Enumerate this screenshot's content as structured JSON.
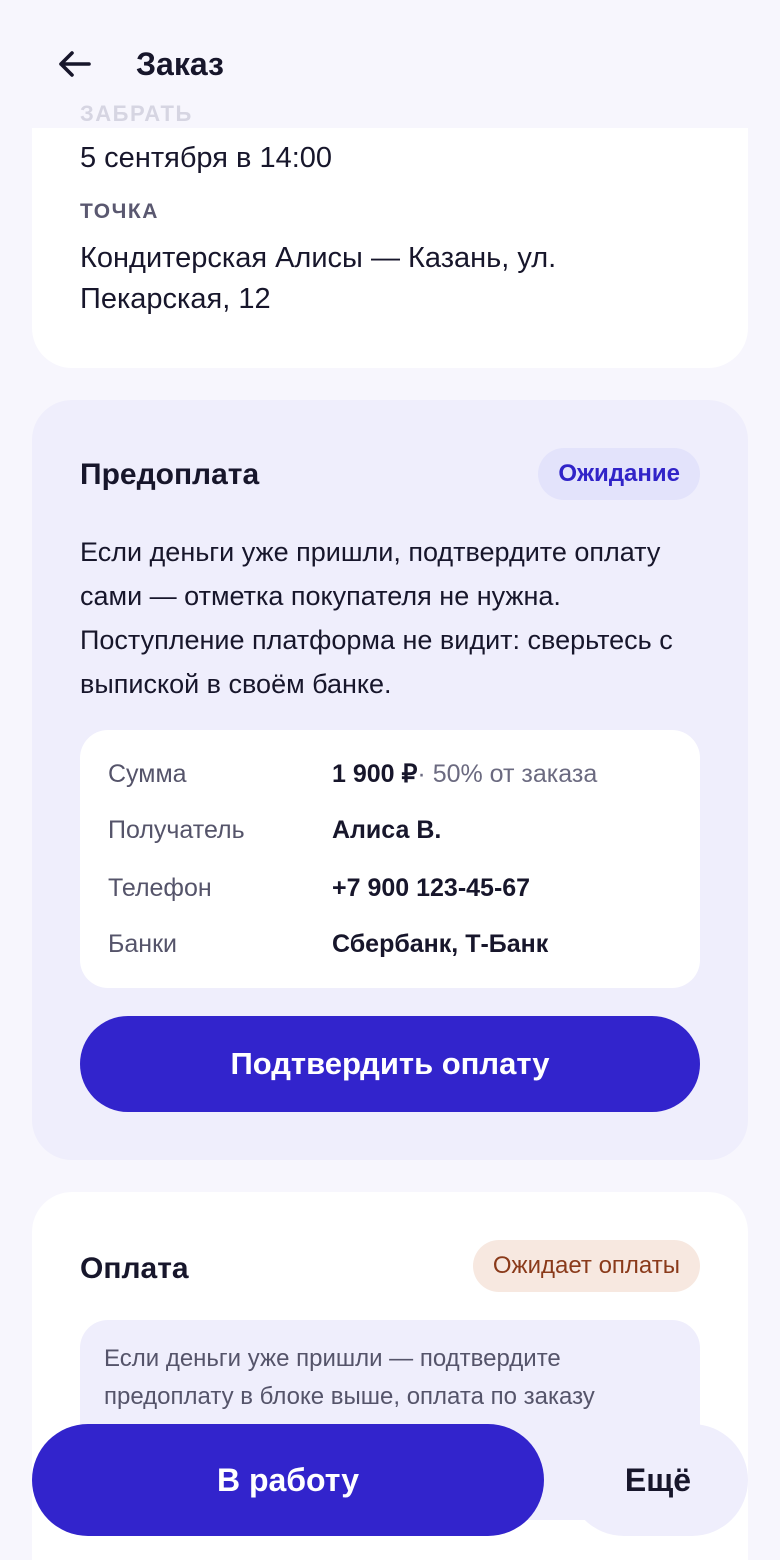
{
  "header": {
    "title": "Заказ",
    "faded_section_label": "ЗАБРАТЬ"
  },
  "pickup": {
    "date": "5 сентября в 14:00",
    "point_label": "ТОЧКА",
    "point_value": "Кондитерская Алисы — Казань, ул. Пекарская, 12"
  },
  "prepayment": {
    "title": "Предоплата",
    "status": "Ожидание",
    "description": "Если деньги уже пришли, подтвердите оплату сами — отметка покупателя не нужна. Поступление платформа не видит: сверьтесь с выпиской в своём банке.",
    "details": {
      "amount_label": "Сумма",
      "amount_value": "1 900 ₽",
      "amount_extra": " · 50% от заказа",
      "recipient_label": "Получатель",
      "recipient_value": "Алиса В.",
      "phone_label": "Телефон",
      "phone_value": "+7 900 123-45-67",
      "banks_label": "Банки",
      "banks_value": "Сбербанк, Т-Банк"
    },
    "confirm_button": "Подтвердить оплату"
  },
  "payment": {
    "title": "Оплата",
    "status": "Ожидает оплаты",
    "note": "Если деньги уже пришли — подтвердите предоплату в блоке выше, оплата по заказу"
  },
  "actions": {
    "primary": "В работу",
    "more": "Ещё"
  },
  "colors": {
    "accent": "#3224cc",
    "background": "#f7f6fd",
    "card_tint": "#efeefc",
    "badge_pending_bg": "#e3e3fb",
    "badge_await_bg": "#f7e8e0",
    "badge_await_text": "#8a3a1a"
  }
}
